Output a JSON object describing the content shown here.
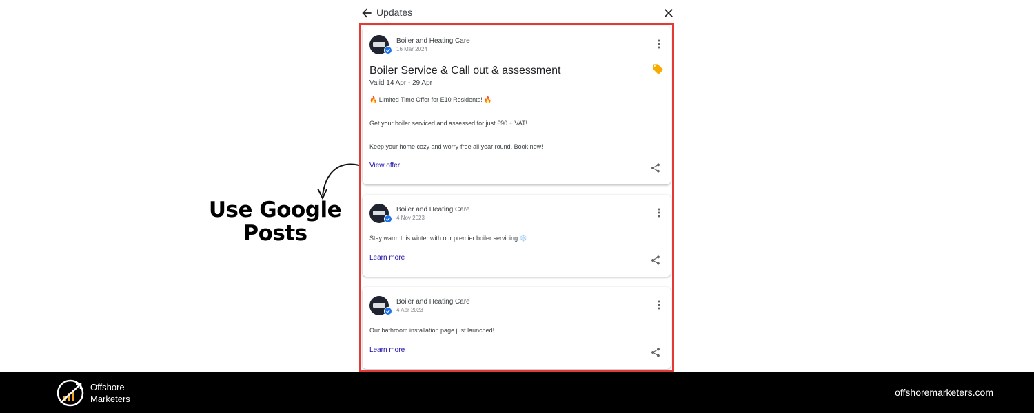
{
  "header": {
    "title": "Updates"
  },
  "posts": [
    {
      "business": "Boiler and Heating Care",
      "date": "16 Mar 2024",
      "title": "Boiler Service & Call out & assessment",
      "valid": "Valid 14 Apr - 29 Apr",
      "lines": [
        "Limited Time Offer for E10 Residents!",
        "Get your boiler serviced and assessed for just £90 + VAT!",
        "Keep your home cozy and worry-free all year round. Book now!"
      ],
      "link": "View offer"
    },
    {
      "business": "Boiler and Heating Care",
      "date": "4 Nov 2023",
      "text": "Stay warm this winter with our premier boiler servicing",
      "emoji": "❄️",
      "link": "Learn more"
    },
    {
      "business": "Boiler and Heating Care",
      "date": "4 Apr 2023",
      "text": "Our bathroom installation page just launched!",
      "link": "Learn more"
    }
  ],
  "annotation": {
    "line1": "Use Google",
    "line2": "Posts"
  },
  "footer": {
    "brand_line1": "Offshore",
    "brand_line2": "Marketers",
    "website": "offshoremarketers.com"
  },
  "colors": {
    "highlight": "#e53935",
    "link": "#1a0dab",
    "verified": "#1a73e8",
    "tag": "#f9ab00",
    "footer": "#000000"
  },
  "icons": [
    "back-arrow-icon",
    "close-icon",
    "verified-badge-icon",
    "more-vert-icon",
    "tag-icon",
    "fire-icon",
    "snowflake-icon",
    "share-icon"
  ]
}
